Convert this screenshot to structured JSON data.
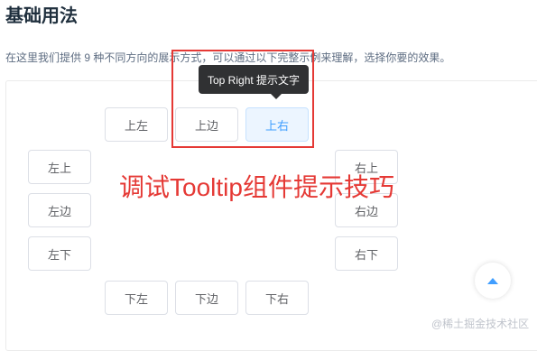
{
  "page": {
    "title": "基础用法",
    "description": "在这里我们提供 9 种不同方向的展示方式，可以通过以下完整示例来理解，选择你要的效果。"
  },
  "tooltip": {
    "text": "Top Right 提示文字"
  },
  "buttons": {
    "top_start": "上左",
    "top": "上边",
    "top_end": "上右",
    "left_start": "左上",
    "left": "左边",
    "left_end": "左下",
    "right_start": "右上",
    "right": "右边",
    "right_end": "右下",
    "bottom_start": "下左",
    "bottom": "下边",
    "bottom_end": "下右"
  },
  "annotation": {
    "text": "调试Tooltip组件提示技巧",
    "color": "#e53935"
  },
  "back_to_top": {
    "icon": "caret-up-icon"
  },
  "watermark": {
    "text": "@稀土掘金技术社区"
  },
  "colors": {
    "primary": "#409eff",
    "tooltip_bg": "#303133",
    "highlight": "#e53935"
  }
}
